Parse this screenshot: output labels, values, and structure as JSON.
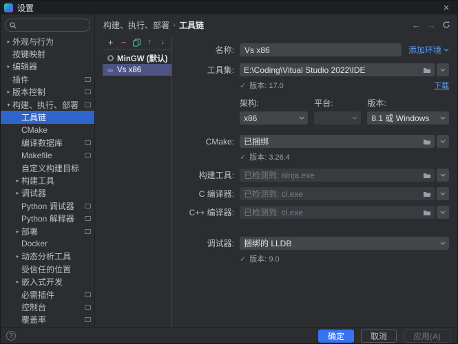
{
  "window": {
    "title": "设置"
  },
  "sidebar": {
    "search_placeholder": "",
    "items": [
      {
        "label": "外观与行为",
        "chev": "▸"
      },
      {
        "label": "按键映射"
      },
      {
        "label": "编辑器",
        "chev": "▸"
      },
      {
        "label": "插件",
        "badge": true
      },
      {
        "label": "版本控制",
        "chev": "▸",
        "badge": true
      },
      {
        "label": "构建、执行、部署",
        "chev": "▾",
        "badge": true
      },
      {
        "label": "工具链",
        "child": true,
        "selected": true
      },
      {
        "label": "CMake",
        "child": true
      },
      {
        "label": "编译数据库",
        "child": true,
        "badge": true
      },
      {
        "label": "Makefile",
        "child": true,
        "badge": true
      },
      {
        "label": "自定义构建目标",
        "child": true
      },
      {
        "label": "构建工具",
        "child": true,
        "chev": "▸"
      },
      {
        "label": "调试器",
        "child": true,
        "chev": "▸"
      },
      {
        "label": "Python 调试器",
        "child": true,
        "badge": true
      },
      {
        "label": "Python 解释器",
        "child": true,
        "badge": true
      },
      {
        "label": "部署",
        "child": true,
        "chev": "▸",
        "badge": true
      },
      {
        "label": "Docker",
        "child": true
      },
      {
        "label": "动态分析工具",
        "child": true,
        "chev": "▸"
      },
      {
        "label": "受信任的位置",
        "child": true
      },
      {
        "label": "嵌入式开发",
        "child": true,
        "chev": "▸"
      },
      {
        "label": "必需插件",
        "child": true,
        "badge": true
      },
      {
        "label": "控制台",
        "child": true,
        "badge": true
      },
      {
        "label": "覆盖率",
        "child": true,
        "badge": true
      }
    ]
  },
  "breadcrumb": {
    "parent": "构建、执行、部署",
    "separator": "›",
    "current": "工具链"
  },
  "toolchains": {
    "items": [
      {
        "label": "MinGW (默认)"
      },
      {
        "label": "Vs x86"
      }
    ]
  },
  "form": {
    "name": {
      "label": "名称:",
      "value": "Vs x86"
    },
    "add_env_link": "添加环境",
    "toolset": {
      "label": "工具集:",
      "value": "E:\\Coding\\Vitual Studio 2022\\IDE",
      "version_note": "版本: 17.0"
    },
    "download_link": "下载",
    "architecture": {
      "label": "架构:",
      "value": "x86"
    },
    "platform": {
      "label": "平台:",
      "value": ""
    },
    "win_version": {
      "label": "版本:",
      "value": "8.1 或 Windows"
    },
    "cmake": {
      "label": "CMake:",
      "value": "已捆绑",
      "version_note": "版本: 3.26.4"
    },
    "build_tool": {
      "label": "构建工具:",
      "value": "已检测到: ninja.exe"
    },
    "c_compiler": {
      "label": "C 编译器:",
      "value": "已检测到: cl.exe"
    },
    "cpp_compiler": {
      "label": "C++ 编译器:",
      "value": "已检测到: cl.exe"
    },
    "debugger": {
      "label": "调试器:",
      "value": "捆绑的 LLDB",
      "version_note": "版本: 9.0"
    }
  },
  "footer": {
    "ok": "确定",
    "cancel": "取消",
    "apply": "应用(A)"
  }
}
